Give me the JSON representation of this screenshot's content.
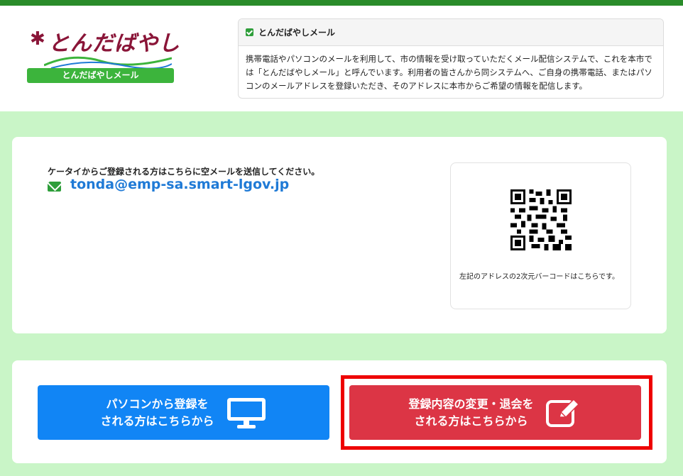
{
  "logo": {
    "title": "とんだばやし",
    "badge": "とんだばやしメール"
  },
  "info": {
    "heading": "とんだばやしメール",
    "body": "携帯電話やパソコンのメールを利用して、市の情報を受け取っていただくメール配信システムで、これを本市では「とんだばやしメール」と呼んでいます。利用者の皆さんから同システムへ、ご自身の携帯電話、またはパソコンのメールアドレスを登録いただき、そのアドレスに本市からご希望の情報を配信します。"
  },
  "mobile": {
    "caption": "ケータイからご登録される方はこちらに空メールを送信してください。",
    "email": "tonda@emp-sa.smart-lgov.jp",
    "qr_caption": "左記のアドレスの2次元バーコードはこちらです。"
  },
  "buttons": {
    "pc": {
      "line1": "パソコンから登録を",
      "line2": "される方はこちらから"
    },
    "change": {
      "line1": "登録内容の変更・退会を",
      "line2": "される方はこちらから"
    }
  },
  "colors": {
    "top_bar": "#2a8c2a",
    "page_bg": "#c9f5c7",
    "pc_button": "#1185f5",
    "change_button": "#dc3545",
    "highlight": "#ee0000",
    "link": "#1f7ad6"
  }
}
